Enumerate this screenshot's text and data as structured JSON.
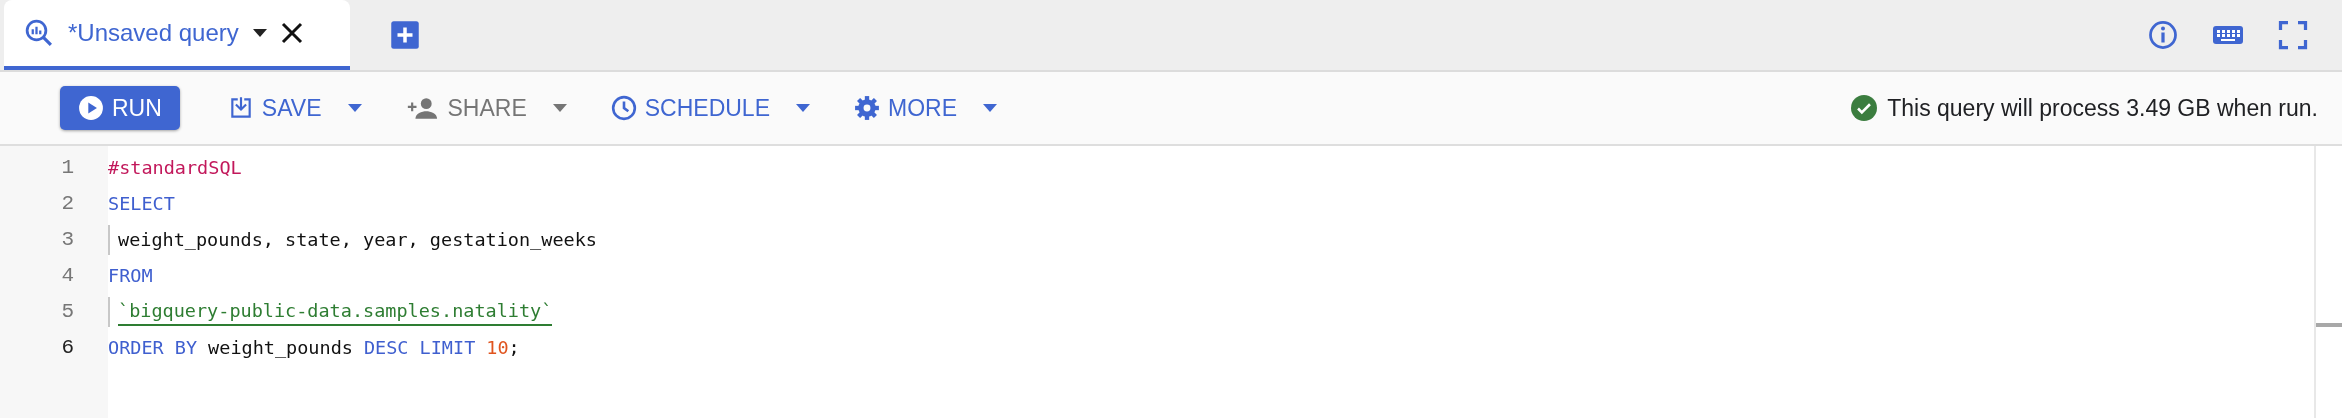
{
  "tabs": [
    {
      "label": "*Unsaved query",
      "selected": true
    }
  ],
  "toolbar": {
    "buttons": [
      {
        "label": "RUN",
        "kind": "primary",
        "disabled": false
      },
      {
        "label": "SAVE",
        "kind": "menu",
        "disabled": false
      },
      {
        "label": "SHARE",
        "kind": "menu",
        "disabled": true
      },
      {
        "label": "SCHEDULE",
        "kind": "menu",
        "disabled": false
      },
      {
        "label": "MORE",
        "kind": "menu",
        "disabled": false
      }
    ],
    "status": "This query will process 3.49 GB when run."
  },
  "editor": {
    "lines": [
      {
        "number": "1",
        "current": false,
        "guide": false,
        "tokens": [
          {
            "text": "#standardSQL",
            "kind": "comment"
          }
        ]
      },
      {
        "number": "2",
        "current": false,
        "guide": false,
        "tokens": [
          {
            "text": "SELECT",
            "kind": "keyword"
          }
        ]
      },
      {
        "number": "3",
        "current": false,
        "guide": true,
        "tokens": [
          {
            "text": "weight_pounds, state, year, gestation_weeks",
            "kind": "plain"
          }
        ]
      },
      {
        "number": "4",
        "current": false,
        "guide": false,
        "tokens": [
          {
            "text": "FROM",
            "kind": "keyword"
          }
        ]
      },
      {
        "number": "5",
        "current": false,
        "guide": true,
        "tokens": [
          {
            "text": "`bigquery-public-data.samples.natality`",
            "kind": "string"
          }
        ]
      },
      {
        "number": "6",
        "current": true,
        "guide": false,
        "tokens": [
          {
            "text": "ORDER BY",
            "kind": "keyword"
          },
          {
            "text": "weight_pounds",
            "kind": "plain"
          },
          {
            "text": "DESC LIMIT",
            "kind": "keyword"
          },
          {
            "text": "10",
            "kind": "number"
          },
          {
            "text": ";",
            "kind": "punctuation"
          }
        ]
      }
    ]
  }
}
